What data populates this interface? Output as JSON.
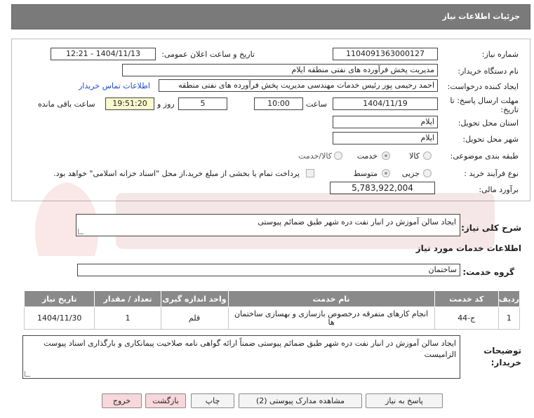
{
  "header": {
    "title": "جزئیات اطلاعات نیاز"
  },
  "form": {
    "need_number_label": "شماره نیاز:",
    "need_number": "1104091363000127",
    "announce_label": "تاریخ و ساعت اعلان عمومی:",
    "announce_value": "1404/11/13 - 12:21",
    "buyer_org_label": "نام دستگاه خریدار:",
    "buyer_org": "مدیریت پخش فرآورده های نفتی منطقه ایلام",
    "requester_label": "ایجاد کننده درخواست:",
    "requester": "احمد  رحیمی پور رئیس خدمات مهندسی مدیریت پخش فرآورده های نفتی منطقه",
    "contact_link": "اطلاعات تماس خریدار",
    "deadline_label_1": "مهلت ارسال پاسخ: تا",
    "deadline_label_2": "تاریخ:",
    "deadline_date": "1404/11/19",
    "time_label": "ساعت",
    "deadline_time": "10:00",
    "days_value": "5",
    "days_label": "روز و",
    "remaining_time": "19:51:20",
    "remaining_label": "ساعت باقی مانده",
    "province_label": "استان محل تحویل:",
    "province": "ایلام",
    "city_label": "شهر محل تحویل:",
    "city": "ایلام",
    "category_label": "طبقه بندی موضوعی:",
    "category_options": [
      "کالا",
      "خدمت",
      "کالا/خدمت"
    ],
    "category_selected": "خدمت",
    "process_label": "نوع فرآیند خرید :",
    "process_options": [
      "جزیی",
      "متوسط"
    ],
    "process_selected": "متوسط",
    "payment_note": "پرداخت تمام یا بخشی از مبلغ خرید،از محل \"اسناد خزانه اسلامی\" خواهد بود.",
    "estimate_label": "برآورد مالی:",
    "estimate": "5,783,922,004"
  },
  "summary": {
    "label": "شرح کلی نیاز:",
    "text": "ایجاد سالن آموزش در انبار نفت دره شهر طبق ضمائم پیوستی"
  },
  "services": {
    "section_title": "اطلاعات خدمات مورد نیاز",
    "group_label": "گروه خدمت:",
    "group_value": "ساختمان",
    "columns": [
      "ردیف",
      "کد خدمت",
      "نام خدمت",
      "واحد اندازه گیری",
      "تعداد / مقدار",
      "تاریخ نیاز"
    ],
    "rows": [
      {
        "index": "1",
        "code": "ج-44",
        "name_line1": "انجام کارهای متفرقه درخصوص بازسازی و بهسازی ساختمان",
        "name_line2": "ها",
        "unit": "قلم",
        "qty": "1",
        "date": "1404/11/30"
      }
    ]
  },
  "buyer_notes": {
    "label_1": "توضیحات",
    "label_2": "خریدار:",
    "text": "ایجاد سالن آموزش در انبار نفت دره شهر طبق ضمائم پیوستی ضمناً ارائه گواهی نامه صلاحیت پیمانکاری و بارگذاری اسناد پیوست الزامیست"
  },
  "buttons": {
    "reply": "پاسخ به نیاز",
    "docs": "مشاهده مدارک پیوستی (2)",
    "print": "چاپ",
    "back": "بازگشت",
    "exit": "خروج"
  }
}
